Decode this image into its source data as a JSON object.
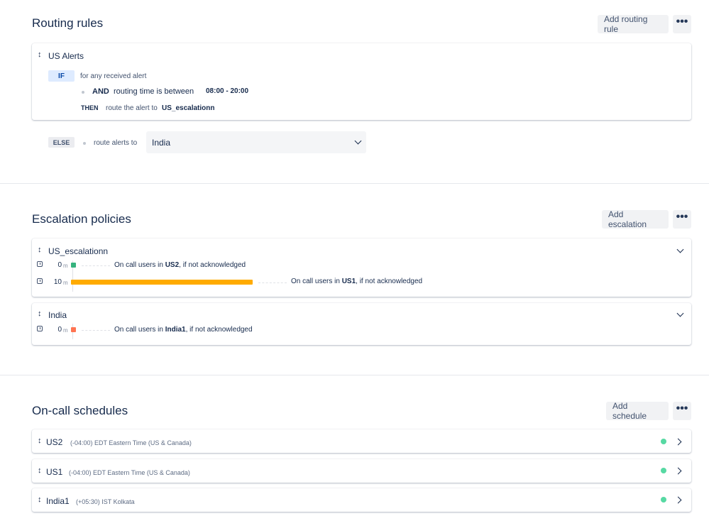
{
  "routing": {
    "title": "Routing rules",
    "add_button": "Add routing rule",
    "more_label": "•••",
    "rule": {
      "name": "US Alerts",
      "if_label": "IF",
      "condition": "for any received alert",
      "and_label": "AND",
      "and_text": "routing time is between",
      "time_range": "08:00 - 20:00",
      "then_label": "THEN",
      "then_text": "route the alert to",
      "target": "US_escalationn"
    },
    "else": {
      "label": "ELSE",
      "text": "route alerts to",
      "selected": "India"
    }
  },
  "escalation": {
    "title": "Escalation policies",
    "add_button": "Add escalation",
    "more_label": "•••",
    "policies": [
      {
        "name": "US_escalationn",
        "steps": [
          {
            "time": "0",
            "unit": "m",
            "prefix": "On call users in ",
            "target": "US2",
            "suffix": ", if not acknowledged",
            "color": "#36b37e"
          },
          {
            "time": "10",
            "unit": "m",
            "prefix": "On call users in ",
            "target": "US1",
            "suffix": ", if not acknowledged",
            "color": "#ffab00"
          }
        ]
      },
      {
        "name": "India",
        "steps": [
          {
            "time": "0",
            "unit": "m",
            "prefix": "On call users in ",
            "target": "India1",
            "suffix": ", if not acknowledged",
            "color": "#ff7452"
          }
        ]
      }
    ]
  },
  "schedules": {
    "title": "On-call schedules",
    "add_button": "Add schedule",
    "more_label": "•••",
    "items": [
      {
        "name": "US2",
        "timezone": "(-04:00) EDT Eastern Time (US & Canada)",
        "status_color": "#57d9a3"
      },
      {
        "name": "US1",
        "timezone": "(-04:00) EDT Eastern Time (US & Canada)",
        "status_color": "#57d9a3"
      },
      {
        "name": "India1",
        "timezone": "(+05:30) IST Kolkata",
        "status_color": "#57d9a3"
      }
    ]
  },
  "icons": {
    "drag": "drag-handle-icon",
    "clock": "clock-icon",
    "chevron_down": "chevron-down-icon",
    "chevron_right": "chevron-right-icon",
    "more": "more-icon"
  },
  "colors": {
    "text": "#172b4d",
    "if_bg": "#deebff",
    "button_bg": "#f1f2f4"
  }
}
